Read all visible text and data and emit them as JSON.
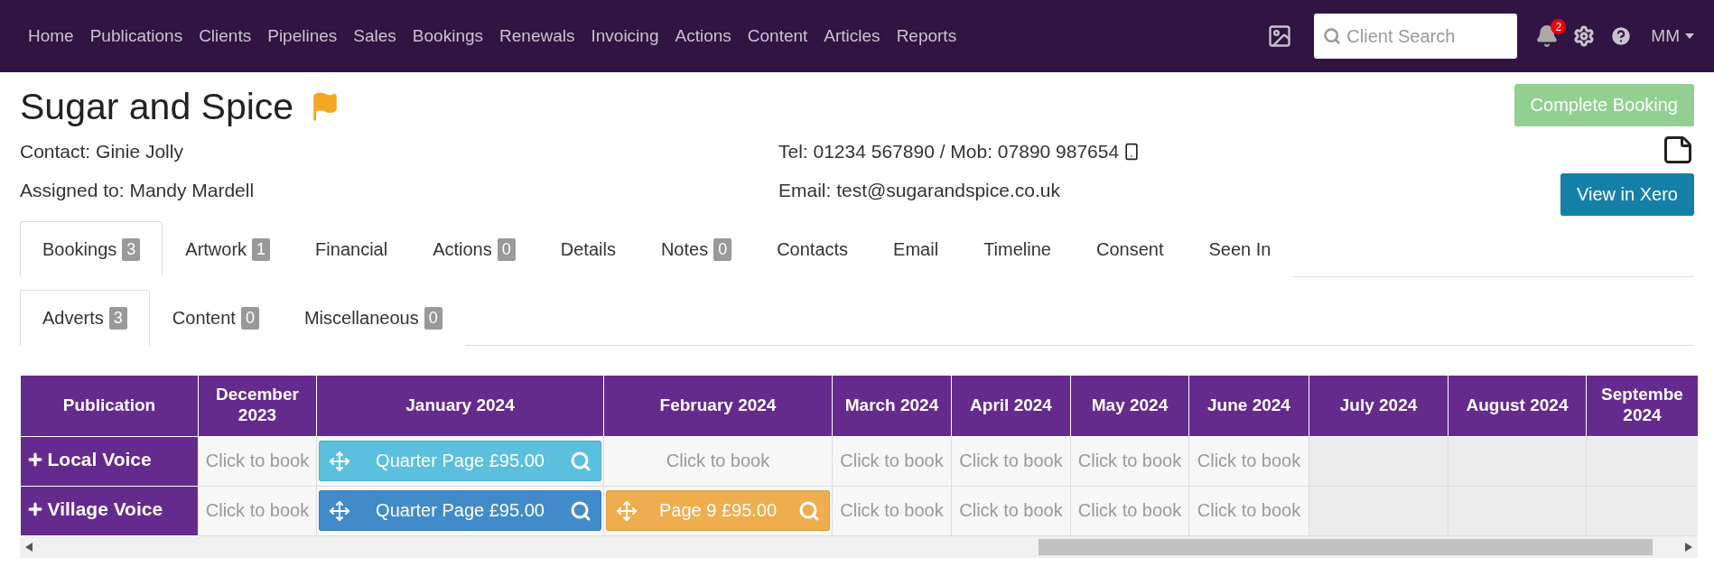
{
  "nav": {
    "items": [
      "Home",
      "Publications",
      "Clients",
      "Pipelines",
      "Sales",
      "Bookings",
      "Renewals",
      "Invoicing",
      "Actions",
      "Content",
      "Articles",
      "Reports"
    ],
    "search": {
      "placeholder": "Client Search"
    },
    "notifications": "2",
    "user": "MM"
  },
  "client": {
    "name": "Sugar and Spice",
    "flagged": true,
    "contact": "Contact: Ginie Jolly",
    "assigned": "Assigned to: Mandy Mardell",
    "phone": "Tel: 01234 567890 / Mob: 07890 987654",
    "email": "Email: test@sugarandspice.co.uk"
  },
  "complete_button": "Complete Booking",
  "xero_button": "View in Xero",
  "tabs": [
    {
      "label": "Bookings",
      "count": "3",
      "selected": true
    },
    {
      "label": "Artwork",
      "count": "1",
      "selected": false
    },
    {
      "label": "Financial",
      "selected": false
    },
    {
      "label": "Actions",
      "count": "0",
      "selected": false
    },
    {
      "label": "Details",
      "selected": false
    },
    {
      "label": "Notes",
      "count": "0",
      "selected": false
    },
    {
      "label": "Contacts",
      "selected": false
    },
    {
      "label": "Email",
      "selected": false
    },
    {
      "label": "Timeline",
      "selected": false
    },
    {
      "label": "Consent",
      "selected": false
    },
    {
      "label": "Seen In",
      "selected": false
    }
  ],
  "subtabs": [
    {
      "label": "Adverts",
      "count": "3",
      "selected": true
    },
    {
      "label": "Content",
      "count": "0",
      "selected": false
    },
    {
      "label": "Miscellaneous",
      "count": "0",
      "selected": false
    }
  ],
  "table": {
    "columns": [
      "Publication",
      "December 2023",
      "January 2024",
      "February 2024",
      "March 2024",
      "April 2024",
      "May 2024",
      "June 2024",
      "July 2024",
      "August 2024",
      "Septembe 2024"
    ],
    "rows": [
      {
        "cells": [
          {
            "kind": "publication",
            "text": "Local Voice"
          },
          {
            "kind": "book",
            "text": "Click to book"
          },
          {
            "kind": "booking",
            "text": "Quarter Page £95.00",
            "color": "#5bc0de"
          },
          {
            "kind": "book",
            "text": "Click to book"
          },
          {
            "kind": "book",
            "text": "Click to book"
          },
          {
            "kind": "book",
            "text": "Click to book"
          },
          {
            "kind": "book",
            "text": "Click to book"
          },
          {
            "kind": "book",
            "text": "Click to book"
          },
          {
            "kind": "empty"
          },
          {
            "kind": "empty"
          },
          {
            "kind": "empty"
          }
        ]
      },
      {
        "cells": [
          {
            "kind": "publication",
            "text": "Village Voice"
          },
          {
            "kind": "book",
            "text": "Click to book"
          },
          {
            "kind": "booking",
            "text": "Quarter Page £95.00",
            "color": "#428bca"
          },
          {
            "kind": "booking",
            "text": "Page 9 £95.00",
            "color": "#f0ad4e"
          },
          {
            "kind": "book",
            "text": "Click to book"
          },
          {
            "kind": "book",
            "text": "Click to book"
          },
          {
            "kind": "book",
            "text": "Click to book"
          },
          {
            "kind": "book",
            "text": "Click to book"
          },
          {
            "kind": "empty"
          },
          {
            "kind": "empty"
          },
          {
            "kind": "empty"
          }
        ]
      }
    ]
  }
}
